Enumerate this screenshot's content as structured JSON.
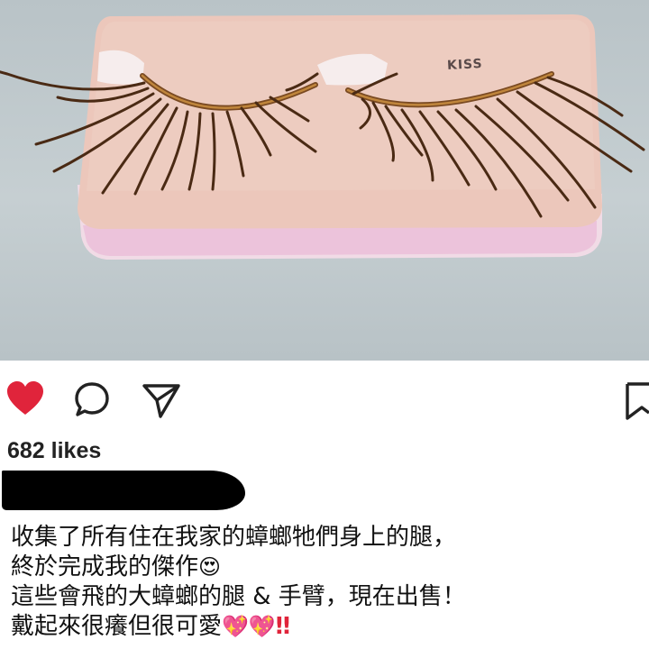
{
  "post": {
    "photo_brand": "KISS",
    "likes": "682 likes",
    "caption_lines": [
      "收集了所有住在我家的蟑螂牠們身上的腿，",
      "終於完成我的傑作",
      "這些會飛的大蟑螂的腿 & 手臂，現在出售！",
      "戴起來很癢但很可愛"
    ],
    "emojis": {
      "line2": "😍",
      "line4": "💖💖",
      "line4_bangs": "‼"
    }
  },
  "icons": {
    "like": "heart-icon",
    "comment": "comment-bubble-icon",
    "share": "paper-plane-icon",
    "save": "bookmark-icon"
  },
  "colors": {
    "like_red": "#e0243b",
    "tray_pink": "#ecc9c0",
    "tray_edge": "#f3dde8",
    "lash_brown": "#4a2a14"
  }
}
